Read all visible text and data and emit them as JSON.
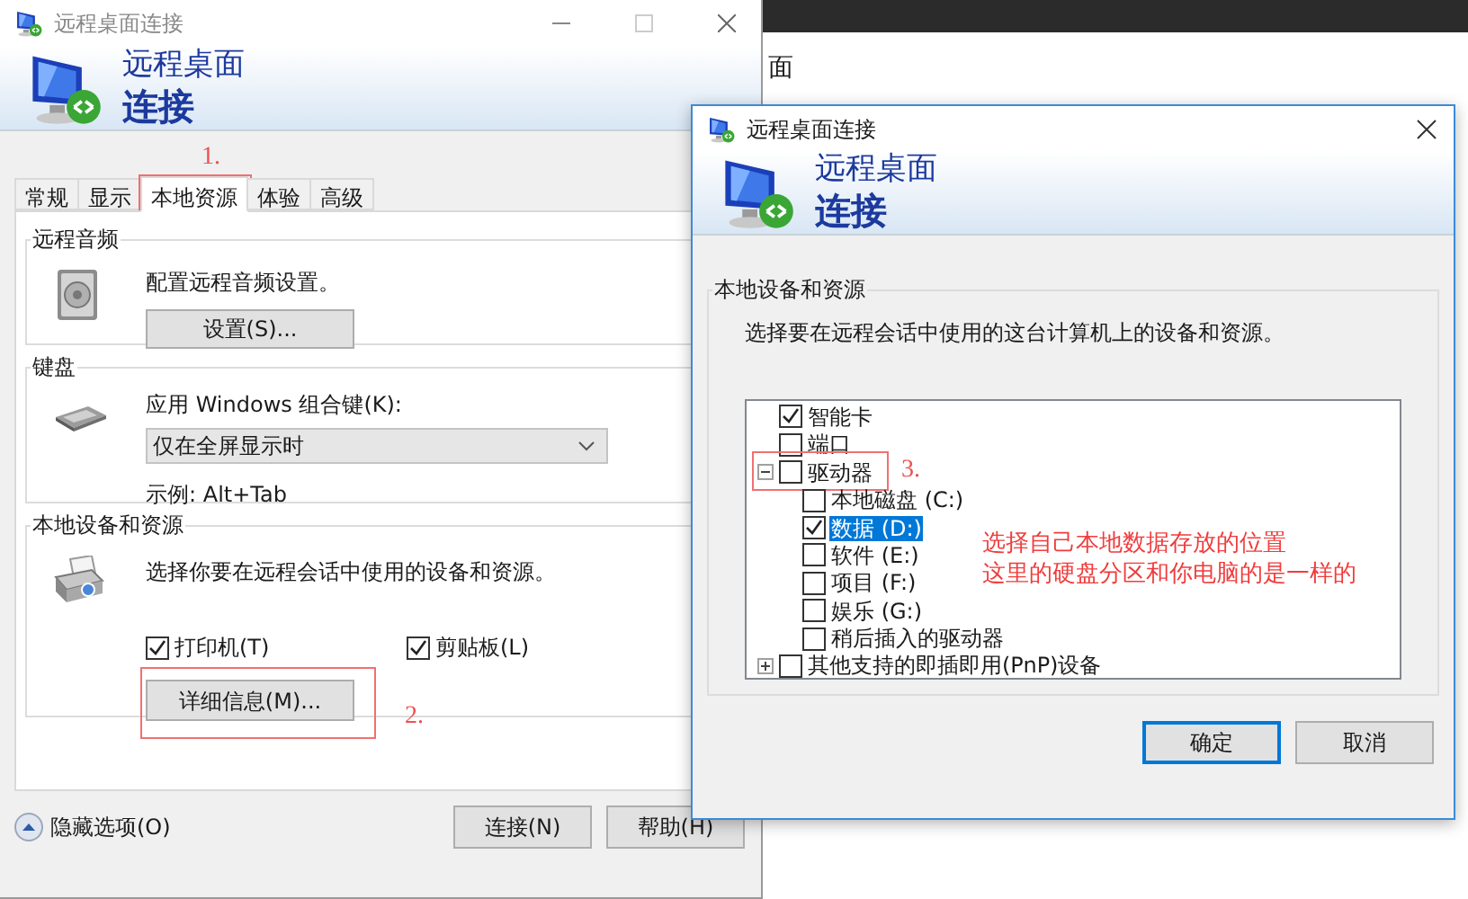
{
  "desktop": {
    "background_text": "面"
  },
  "main_window": {
    "title": "远程桌面连接",
    "banner": {
      "line1": "远程桌面",
      "line2": "连接"
    },
    "tabs": [
      {
        "label": "常规",
        "selected": false
      },
      {
        "label": "显示",
        "selected": false
      },
      {
        "label": "本地资源",
        "selected": true,
        "annotation": "1."
      },
      {
        "label": "体验",
        "selected": false
      },
      {
        "label": "高级",
        "selected": false
      }
    ],
    "groups": [
      {
        "kind": "audio",
        "legend": "远程音频",
        "description": "配置远程音频设置。",
        "button": {
          "label": "设置(S)..."
        }
      },
      {
        "kind": "keyboard",
        "legend": "键盘",
        "label": "应用 Windows 组合键(K):",
        "dropdown": {
          "value": "仅在全屏显示时"
        },
        "example": "示例: Alt+Tab"
      },
      {
        "kind": "devices",
        "legend": "本地设备和资源",
        "description": "选择你要在远程会话中使用的设备和资源。",
        "checkboxes": [
          {
            "label": "打印机(T)",
            "checked": true
          },
          {
            "label": "剪贴板(L)",
            "checked": true
          }
        ],
        "button": {
          "label": "详细信息(M)...",
          "annotation": "2."
        }
      }
    ],
    "options_toggle": {
      "label": "隐藏选项(O)"
    },
    "buttons": [
      {
        "label": "连接(N)"
      },
      {
        "label": "帮助(H)"
      }
    ]
  },
  "dialog": {
    "title": "远程桌面连接",
    "banner": {
      "line1": "远程桌面",
      "line2": "连接"
    },
    "group": {
      "legend": "本地设备和资源",
      "description": "选择要在远程会话中使用的这台计算机上的设备和资源。",
      "tree": [
        {
          "label": "智能卡",
          "checked": true,
          "selected": false
        },
        {
          "label": "端口",
          "checked": false,
          "selected": false
        },
        {
          "label": "驱动器",
          "checked": false,
          "selected": false,
          "expanded": true,
          "annotation": "3.",
          "children": [
            {
              "label": "本地磁盘 (C:)",
              "checked": false,
              "selected": false
            },
            {
              "label": "数据 (D:)",
              "checked": true,
              "selected": true
            },
            {
              "label": "软件 (E:)",
              "checked": false,
              "selected": false
            },
            {
              "label": "项目 (F:)",
              "checked": false,
              "selected": false
            },
            {
              "label": "娱乐 (G:)",
              "checked": false,
              "selected": false
            },
            {
              "label": "稍后插入的驱动器",
              "checked": false,
              "selected": false
            }
          ]
        },
        {
          "label": "其他支持的即插即用(PnP)设备",
          "checked": false,
          "selected": false,
          "expanded": false
        }
      ],
      "note": [
        "选择自己本地数据存放的位置",
        "这里的硬盘分区和你电脑的是一样的"
      ]
    },
    "buttons": [
      {
        "label": "确定",
        "default": true
      },
      {
        "label": "取消",
        "default": false
      }
    ]
  }
}
